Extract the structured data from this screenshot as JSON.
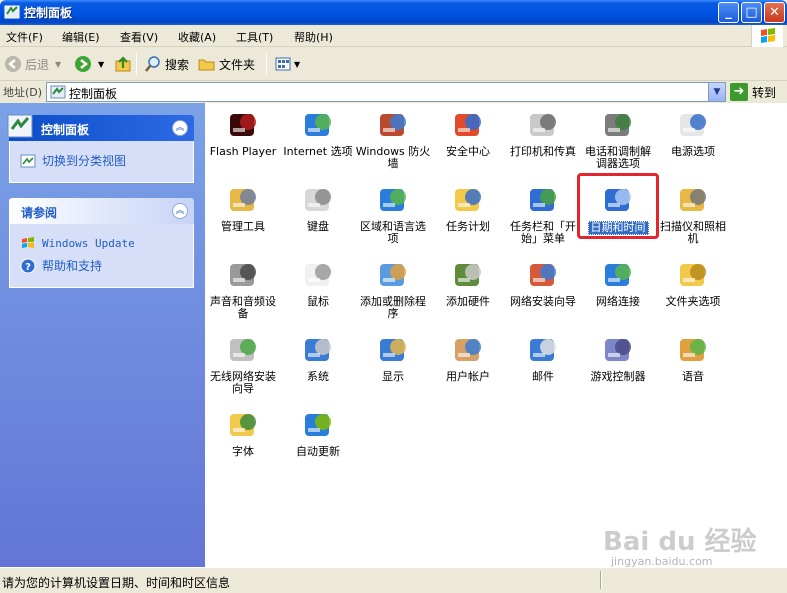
{
  "window": {
    "title": "控制面板"
  },
  "menu": [
    "文件(F)",
    "编辑(E)",
    "查看(V)",
    "收藏(A)",
    "工具(T)",
    "帮助(H)"
  ],
  "toolbar": {
    "back": "后退",
    "search": "搜索",
    "folders": "文件夹"
  },
  "address": {
    "label": "地址(D)",
    "value": "控制面板",
    "go": "转到"
  },
  "sidebar": {
    "panel1": {
      "title": "控制面板",
      "link": "切换到分类视图"
    },
    "panel2": {
      "title": "请参阅",
      "links": [
        "Windows Update",
        "帮助和支持"
      ]
    }
  },
  "items": [
    {
      "label": "Flash Player",
      "icon": "flash-player-icon"
    },
    {
      "label": "Internet 选项",
      "icon": "internet-options-icon"
    },
    {
      "label": "Windows 防火墙",
      "icon": "firewall-icon"
    },
    {
      "label": "安全中心",
      "icon": "security-center-icon"
    },
    {
      "label": "打印机和传真",
      "icon": "printer-icon"
    },
    {
      "label": "电话和调制解调器选项",
      "icon": "phone-modem-icon"
    },
    {
      "label": "电源选项",
      "icon": "power-options-icon"
    },
    {
      "label": "管理工具",
      "icon": "admin-tools-icon"
    },
    {
      "label": "键盘",
      "icon": "keyboard-icon"
    },
    {
      "label": "区域和语言选项",
      "icon": "region-language-icon"
    },
    {
      "label": "任务计划",
      "icon": "scheduled-tasks-icon"
    },
    {
      "label": "任务栏和「开始」菜单",
      "icon": "taskbar-start-menu-icon"
    },
    {
      "label": "日期和时间",
      "icon": "date-time-icon"
    },
    {
      "label": "扫描仪和照相机",
      "icon": "scanner-camera-icon"
    },
    {
      "label": "声音和音频设备",
      "icon": "sound-audio-icon"
    },
    {
      "label": "鼠标",
      "icon": "mouse-icon"
    },
    {
      "label": "添加或删除程序",
      "icon": "add-remove-programs-icon"
    },
    {
      "label": "添加硬件",
      "icon": "add-hardware-icon"
    },
    {
      "label": "网络安装向导",
      "icon": "network-setup-icon"
    },
    {
      "label": "网络连接",
      "icon": "network-connections-icon"
    },
    {
      "label": "文件夹选项",
      "icon": "folder-options-icon"
    },
    {
      "label": "无线网络安装向导",
      "icon": "wireless-setup-icon"
    },
    {
      "label": "系统",
      "icon": "system-icon"
    },
    {
      "label": "显示",
      "icon": "display-icon"
    },
    {
      "label": "用户帐户",
      "icon": "user-accounts-icon"
    },
    {
      "label": "邮件",
      "icon": "mail-icon"
    },
    {
      "label": "游戏控制器",
      "icon": "game-controller-icon"
    },
    {
      "label": "语音",
      "icon": "speech-icon"
    },
    {
      "label": "字体",
      "icon": "fonts-icon"
    },
    {
      "label": "自动更新",
      "icon": "automatic-updates-icon"
    }
  ],
  "selected_item": "日期和时间",
  "status": {
    "text": "请为您的计算机设置日期、时间和时区信息"
  },
  "watermark": {
    "brand": "Bai du 经验",
    "url": "jingyan.baidu.com"
  }
}
